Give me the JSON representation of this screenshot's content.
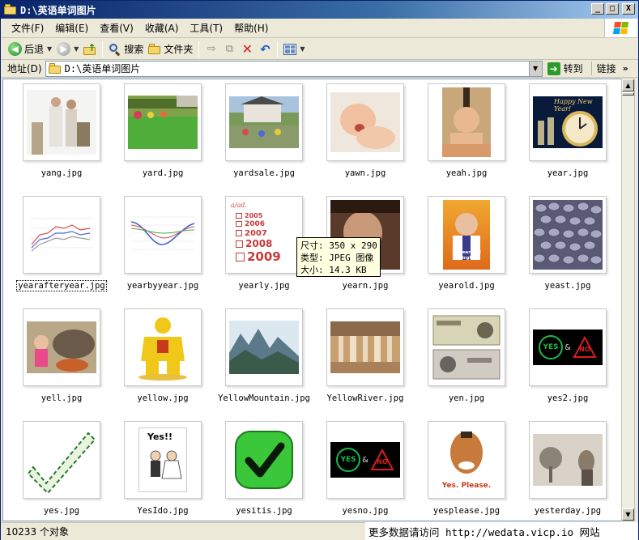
{
  "window": {
    "title": "D:\\英语单词图片",
    "minimize": "_",
    "maximize": "□",
    "close": "X"
  },
  "menu": [
    "文件(F)",
    "编辑(E)",
    "查看(V)",
    "收藏(A)",
    "工具(T)",
    "帮助(H)"
  ],
  "toolbar": {
    "back": "后退",
    "search": "搜索",
    "folders": "文件夹"
  },
  "address": {
    "label": "地址(D)",
    "value": "D:\\英语单词图片",
    "go": "转到",
    "links": "链接"
  },
  "files": [
    "yang.jpg",
    "yard.jpg",
    "yardsale.jpg",
    "yawn.jpg",
    "yeah.jpg",
    "year.jpg",
    "yearafteryear.jpg",
    "yearbyyear.jpg",
    "yearly.jpg",
    "yearn.jpg",
    "yearold.jpg",
    "yeast.jpg",
    "yell.jpg",
    "yellow.jpg",
    "YellowMountain.jpg",
    "YellowRiver.jpg",
    "yen.jpg",
    "yes2.jpg",
    "yes.jpg",
    "YesIdo.jpg",
    "yesitis.jpg",
    "yesno.jpg",
    "yesplease.jpg",
    "yesterday.jpg"
  ],
  "thumb_text": {
    "year_banner": "Happy New Year!",
    "years": [
      "2005",
      "2006",
      "2007",
      "2008",
      "2009"
    ],
    "yearly_corner": "a/ad.",
    "yearold_title": "40-Year-Old Virgin",
    "yes_label": "YES",
    "amp": "&",
    "no_label": "NO",
    "yesido_text": "Yes!!",
    "yesplease_text": "Yes. Please."
  },
  "tooltip": {
    "size": "尺寸: 350 x 290",
    "type": "类型: JPEG 图像",
    "filesize": "大小: 14.3 KB"
  },
  "status": {
    "count": "10233 个对象"
  },
  "watermark": "更多数据请访问 http://wedata.vicp.io 网站"
}
